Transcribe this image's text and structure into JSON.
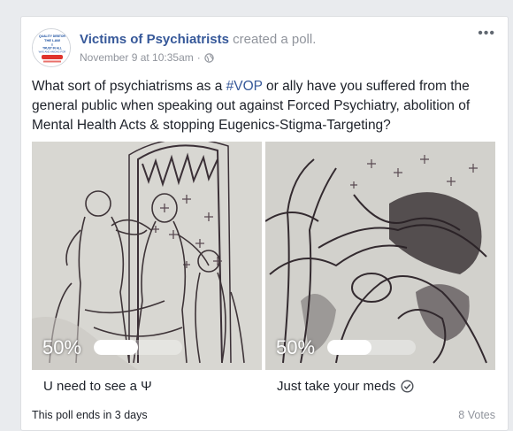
{
  "post": {
    "page_name": "Victims of Psychiatrists",
    "action": "created a poll.",
    "timestamp": "November 9 at 10:35am",
    "separator": "·",
    "privacy_icon": "globe-icon",
    "more_icon": "ellipsis-icon",
    "more_label": "•••"
  },
  "avatar": {
    "logo_lines": [
      "QUALITY DEBTOR",
      "THE LAW",
      "&",
      "TRUST IN ALL",
      "WAS AND AMONG FOR"
    ]
  },
  "question": {
    "before": "What sort of psychiatrisms as a ",
    "hashtag": "#VOP",
    "after": " or ally have you suffered from the general public when speaking out against Forced Psychiatry, abolition of Mental Health Acts & stopping Eugenics-Stigma-Targeting?"
  },
  "poll": {
    "options": [
      {
        "label": "U need to see a Ψ",
        "percent_label": "50%",
        "percent": 50,
        "image": "sketch-drawing-figures"
      },
      {
        "label": "Just take your meds",
        "percent_label": "50%",
        "percent": 50,
        "image": "sketch-drawing-tangled",
        "icon": "check-circle-icon"
      }
    ],
    "ends_text": "This poll ends in 3 days",
    "votes_text": "8 Votes"
  },
  "colors": {
    "link": "#365899",
    "meta": "#90949c",
    "text": "#1d2129",
    "background": "#e9ebee"
  }
}
